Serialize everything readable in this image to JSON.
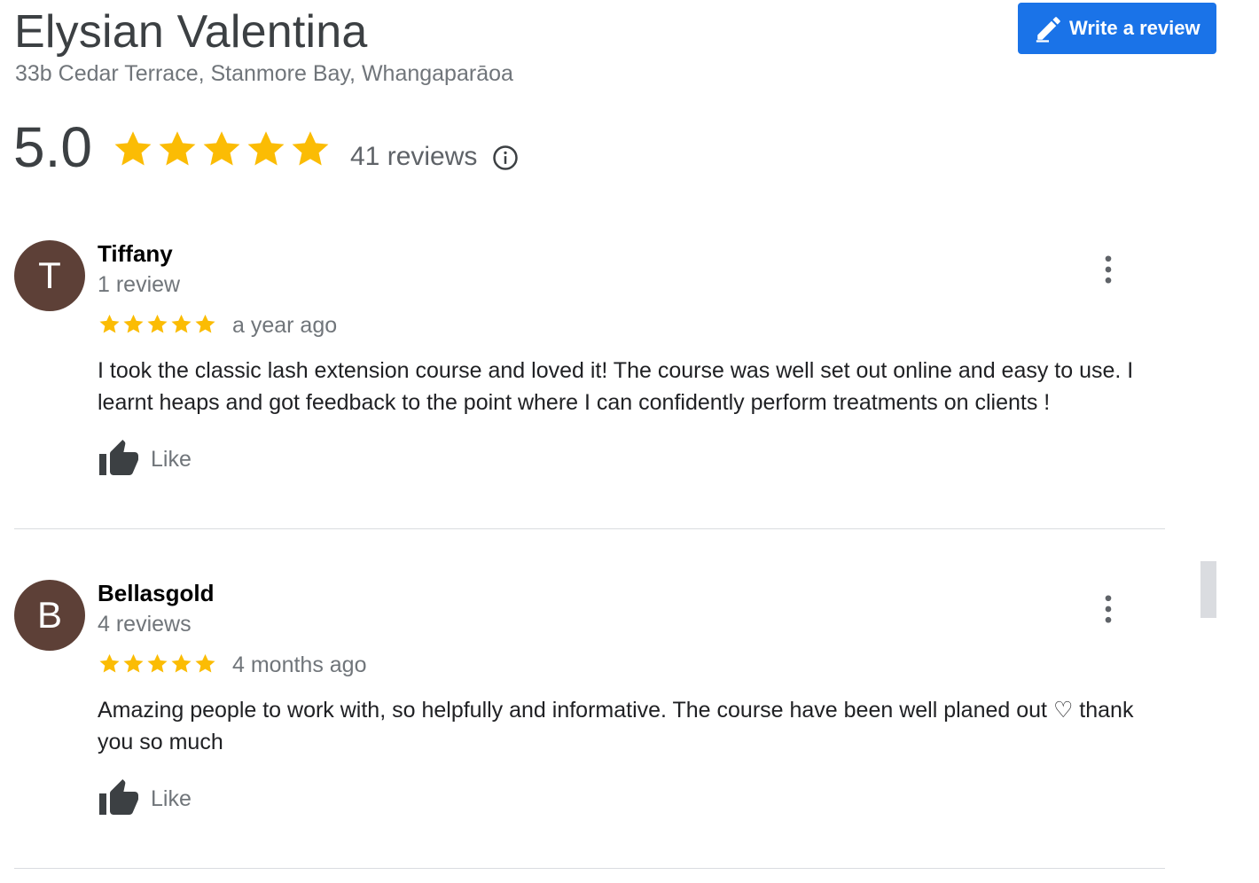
{
  "business": {
    "name": "Elysian Valentina",
    "address": "33b Cedar Terrace, Stanmore Bay, Whangaparāoa"
  },
  "actions": {
    "write_review_label": "Write a review"
  },
  "summary": {
    "rating": "5.0",
    "stars": 5,
    "review_count": "41 reviews",
    "info_icon": "info-icon"
  },
  "colors": {
    "star": "#fbbc04",
    "accent": "#1a73e8",
    "avatar": "#5d4037"
  },
  "reviews": [
    {
      "initial": "T",
      "author": "Tiffany",
      "author_meta": "1 review",
      "stars": 5,
      "time": "a year ago",
      "text": "I took the classic lash extension course and loved it! The course was well set out online and easy to use. I learnt heaps and got feedback to the point where I can confidently perform treatments on clients !",
      "like_label": "Like"
    },
    {
      "initial": "B",
      "author": "Bellasgold",
      "author_meta": "4 reviews",
      "stars": 5,
      "time": "4 months ago",
      "text": "Amazing people to work with, so helpfully and informative. The course have been well planed out ♡ thank you so much",
      "like_label": "Like"
    }
  ]
}
